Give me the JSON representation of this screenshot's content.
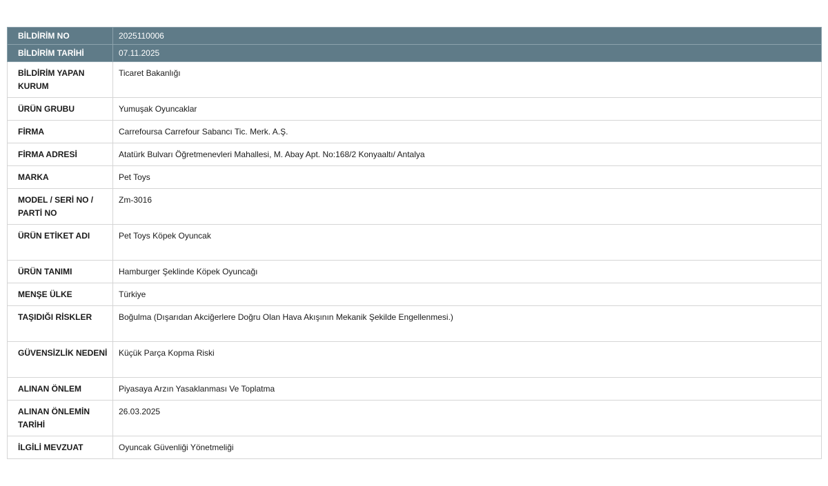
{
  "rows": [
    {
      "label": "BİLDİRİM NO",
      "value": "2025110006",
      "header": true
    },
    {
      "label": "BİLDİRİM TARİHİ",
      "value": "07.11.2025",
      "header": true
    },
    {
      "label": "BİLDİRİM YAPAN KURUM",
      "value": "Ticaret Bakanlığı"
    },
    {
      "label": "ÜRÜN GRUBU",
      "value": "Yumuşak Oyuncaklar"
    },
    {
      "label": "FİRMA",
      "value": "Carrefoursa Carrefour Sabancı Tic. Merk. A.Ş."
    },
    {
      "label": "FİRMA ADRESİ",
      "value": "Atatürk Bulvarı Öğretmenevleri Mahallesi, M. Abay Apt. No:168/2 Konyaaltı/ Antalya"
    },
    {
      "label": "MARKA",
      "value": "Pet Toys"
    },
    {
      "label": "MODEL / SERİ NO / PARTİ NO",
      "value": "Zm-3016"
    },
    {
      "label": "ÜRÜN ETİKET ADI",
      "value": "Pet Toys Köpek Oyuncak"
    },
    {
      "label": "ÜRÜN TANIMI",
      "value": "Hamburger Şeklinde Köpek Oyuncağı"
    },
    {
      "label": "MENŞE ÜLKE",
      "value": "Türkiye"
    },
    {
      "label": "TAŞIDIĞI RİSKLER",
      "value": "Boğulma (Dışarıdan Akciğerlere Doğru Olan Hava Akışının Mekanik Şekilde Engellenmesi.)"
    },
    {
      "label": "GÜVENSİZLİK NEDENİ",
      "value": "Küçük Parça Kopma Riski"
    },
    {
      "label": "ALINAN ÖNLEM",
      "value": "Piyasaya Arzın Yasaklanması Ve Toplatma"
    },
    {
      "label": "ALINAN ÖNLEMİN TARİHİ",
      "value": "26.03.2025"
    },
    {
      "label": "İLGİLİ MEVZUAT",
      "value": "Oyuncak Güvenliği Yönetmeliği"
    }
  ]
}
